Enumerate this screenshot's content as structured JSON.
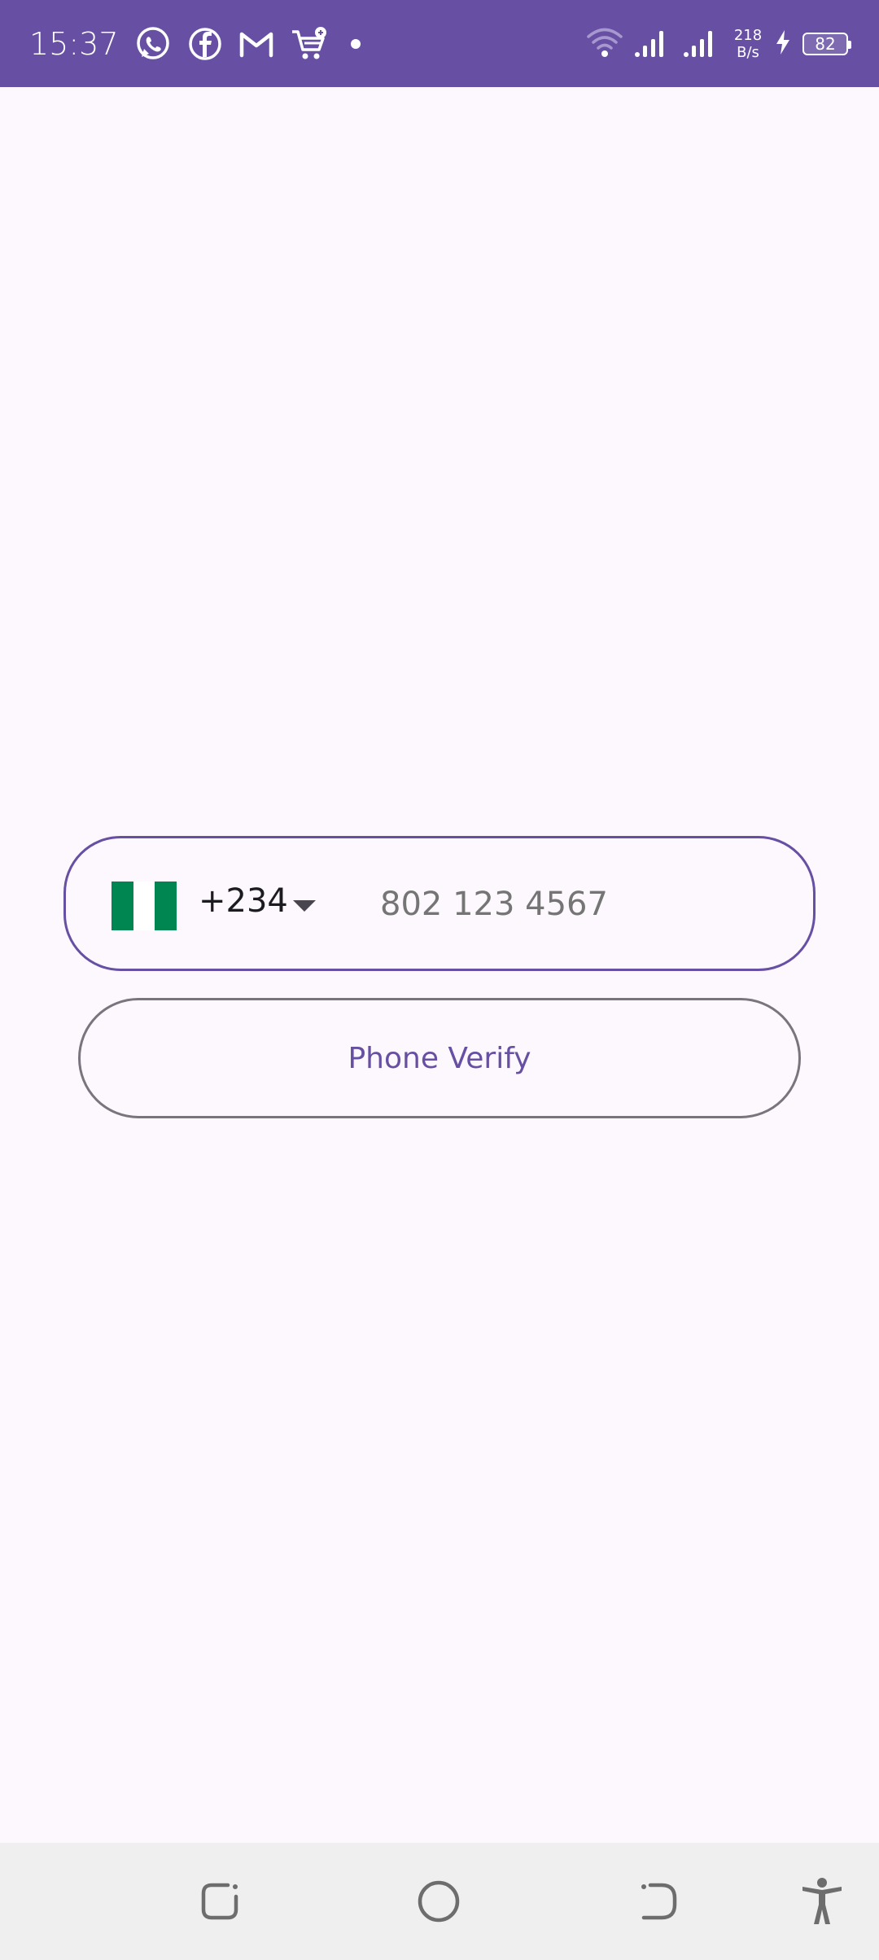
{
  "status_bar": {
    "time": "15:37",
    "notification_icons": [
      "whatsapp-icon",
      "facebook-icon",
      "gmail-icon",
      "shopping-cart-icon",
      "dot-icon"
    ],
    "net_speed_value": "218",
    "net_speed_unit": "B/s",
    "battery_level": "82",
    "background_color": "#6750a4"
  },
  "phone_form": {
    "country_flag": "Nigeria",
    "dial_code": "+234",
    "phone_placeholder": "802 123 4567",
    "phone_value": "",
    "border_color": "#6750a4"
  },
  "verify_button": {
    "label": "Phone Verify"
  },
  "nav_bar": {
    "buttons": [
      "recent-apps-icon",
      "home-icon",
      "back-icon",
      "accessibility-icon"
    ]
  }
}
